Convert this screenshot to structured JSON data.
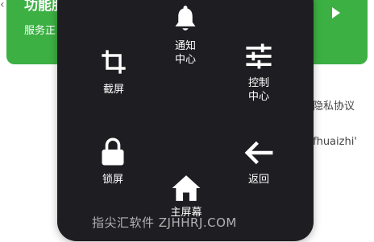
{
  "background": {
    "card_title": "功能服",
    "card_subtitle": "服务正",
    "privacy_text": "隐私协议",
    "link_text": "fhuaizhi'",
    "accent_color": "#3cb043"
  },
  "menu": {
    "notification_label_1": "通知",
    "notification_label_2": "中心",
    "control_label_1": "控制",
    "control_label_2": "中心",
    "screenshot_label": "截屏",
    "lock_label": "锁屏",
    "back_label": "返回",
    "home_label": "主屏幕"
  },
  "watermark": "指尖汇软件 ZJHHRJ.COM"
}
